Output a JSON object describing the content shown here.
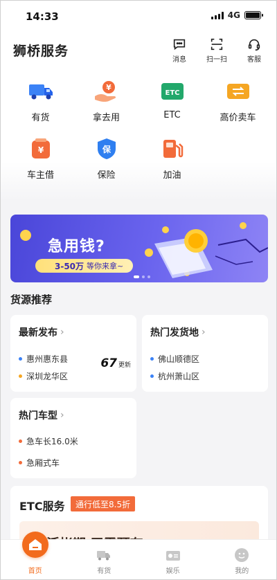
{
  "status_bar": {
    "time": "14:33",
    "network": "4G"
  },
  "header": {
    "title": "狮桥服务",
    "actions": [
      {
        "label": "消息",
        "icon": "message-icon"
      },
      {
        "label": "扫一扫",
        "icon": "scan-icon"
      },
      {
        "label": "客服",
        "icon": "headset-icon"
      }
    ]
  },
  "services": [
    {
      "label": "有货",
      "icon": "truck-icon",
      "color": "#3b82f6"
    },
    {
      "label": "拿去用",
      "icon": "hand-money-icon",
      "color": "#f26b3a"
    },
    {
      "label": "ETC",
      "icon": "etc-icon",
      "color": "#22a86b"
    },
    {
      "label": "高价卖车",
      "icon": "trade-icon",
      "color": "#f5a623"
    },
    {
      "label": "车主借",
      "icon": "wallet-icon",
      "color": "#f26b3a"
    },
    {
      "label": "保险",
      "icon": "shield-icon",
      "color": "#2f7ff0"
    },
    {
      "label": "加油",
      "icon": "fuel-icon",
      "color": "#f26b3a"
    }
  ],
  "banner": {
    "headline": "急用钱?",
    "amount": "3-50万",
    "subtext": "等你来拿~"
  },
  "section_title": "货源推荐",
  "latest": {
    "title": "最新发布",
    "origin": "惠州惠东县",
    "destination": "深圳龙华区",
    "count": "67",
    "count_label": "更新"
  },
  "hot_origins": {
    "title": "热门发货地",
    "items": [
      "佛山顺德区",
      "杭州萧山区"
    ]
  },
  "hot_models": {
    "title": "热门车型",
    "items": [
      "急车长16.0米",
      "急厢式车"
    ]
  },
  "etc": {
    "title": "ETC服务",
    "tag": "通行低至8.5折",
    "promo": "灵活帐期 无需预存"
  },
  "bottom_nav": [
    {
      "label": "首页",
      "icon": "home-icon"
    },
    {
      "label": "有货",
      "icon": "truck-icon"
    },
    {
      "label": "娱乐",
      "icon": "radio-icon"
    },
    {
      "label": "我的",
      "icon": "profile-icon"
    }
  ]
}
